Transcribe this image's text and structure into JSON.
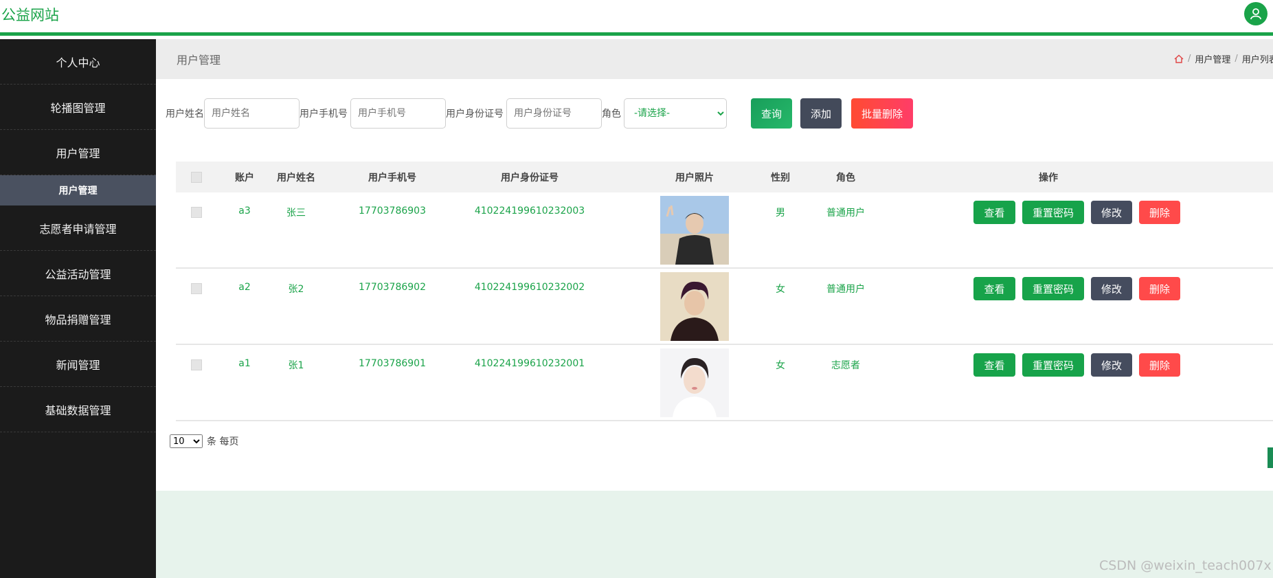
{
  "header": {
    "site_title": "公益网站"
  },
  "sidebar": {
    "items": [
      {
        "label": "个人中心"
      },
      {
        "label": "轮播图管理"
      },
      {
        "label": "用户管理"
      },
      {
        "label": "志愿者申请管理"
      },
      {
        "label": "公益活动管理"
      },
      {
        "label": "物品捐赠管理"
      },
      {
        "label": "新闻管理"
      },
      {
        "label": "基础数据管理"
      }
    ],
    "sub_item": {
      "label": "用户管理"
    }
  },
  "page": {
    "title": "用户管理",
    "breadcrumb": [
      "用户管理",
      "用户列表"
    ]
  },
  "search": {
    "name_label": "用户姓名",
    "name_placeholder": "用户姓名",
    "phone_label": "用户手机号",
    "phone_placeholder": "用户手机号",
    "id_label": "用户身份证号",
    "id_placeholder": "用户身份证号",
    "role_label": "角色",
    "role_selected": "-请选择-",
    "query_button": "查询",
    "add_button": "添加",
    "batch_delete_button": "批量删除"
  },
  "table": {
    "headers": [
      "账户",
      "用户姓名",
      "用户手机号",
      "用户身份证号",
      "用户照片",
      "性别",
      "角色",
      "操作"
    ],
    "rows": [
      {
        "account": "a3",
        "name": "张三",
        "phone": "17703786903",
        "id_number": "410224199610232003",
        "gender": "男",
        "role": "普通用户"
      },
      {
        "account": "a2",
        "name": "张2",
        "phone": "17703786902",
        "id_number": "410224199610232002",
        "gender": "女",
        "role": "普通用户"
      },
      {
        "account": "a1",
        "name": "张1",
        "phone": "17703786901",
        "id_number": "410224199610232001",
        "gender": "女",
        "role": "志愿者"
      }
    ],
    "actions": {
      "view": "查看",
      "reset": "重置密码",
      "edit": "修改",
      "delete": "删除"
    }
  },
  "pager": {
    "page_size": "10",
    "suffix": "条 每页"
  },
  "watermark": "CSDN @weixin_teach007x",
  "colors": {
    "accent": "#1aa349",
    "sidebar": "#1b1b1b",
    "danger": "#ff4a4a",
    "dark_button": "#454c5e"
  }
}
